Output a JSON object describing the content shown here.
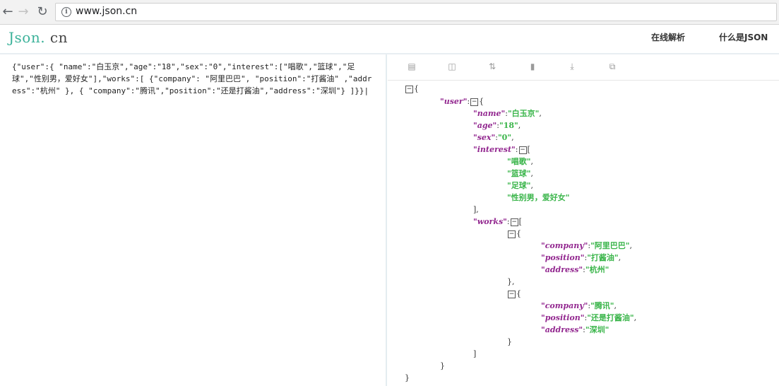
{
  "browser": {
    "back_icon": "arrow-left-icon",
    "forward_icon": "arrow-right-icon",
    "reload_icon": "reload-icon",
    "url": "www.json.cn"
  },
  "site": {
    "logo_main": "Json.",
    "logo_suffix": " cn",
    "nav": [
      "在线解析",
      "什么是JSON"
    ]
  },
  "editor": {
    "raw_text": "{\"user\":{ \"name\":\"白玉京\",\"age\":\"18\",\"sex\":\"0\",\"interest\":[\"唱歌\",\"篮球\",\"足球\",\"性别男，爱好女\"],\"works\":[ {\"company\": \"阿里巴巴\", \"position\":\"打酱油\" ,\"address\":\"杭州\" }, { \"company\":\"腾讯\",\"position\":\"还是打酱油\",\"address\":\"深圳\"} ]}}|"
  },
  "toolbar": {
    "icons": [
      "database-icon",
      "excel-icon",
      "sort-icon",
      "trash-icon",
      "download-icon",
      "copy-icon"
    ]
  },
  "tree": {
    "root_open": "{",
    "user_key": "\"user\"",
    "user_open": "{",
    "name_key": "\"name\"",
    "name_val": "\"白玉京\"",
    "age_key": "\"age\"",
    "age_val": "\"18\"",
    "sex_key": "\"sex\"",
    "sex_val": "\"0\"",
    "interest_key": "\"interest\"",
    "interest_open": "[",
    "interest_items": [
      "\"唱歌\"",
      "\"篮球\"",
      "\"足球\"",
      "\"性别男，爱好女\""
    ],
    "interest_close": "],",
    "works_key": "\"works\"",
    "works_open": "[",
    "work1": {
      "open": "{",
      "company_key": "\"company\"",
      "company_val": "\"阿里巴巴\"",
      "position_key": "\"position\"",
      "position_val": "\"打酱油\"",
      "address_key": "\"address\"",
      "address_val": "\"杭州\"",
      "close": "},"
    },
    "work2": {
      "open": "{",
      "company_key": "\"company\"",
      "company_val": "\"腾讯\"",
      "position_key": "\"position\"",
      "position_val": "\"还是打酱油\"",
      "address_key": "\"address\"",
      "address_val": "\"深圳\"",
      "close": "}"
    },
    "works_close": "]",
    "user_close": "}",
    "root_close": "}",
    "colon": ":",
    "comma": ",",
    "toggle": "−"
  }
}
